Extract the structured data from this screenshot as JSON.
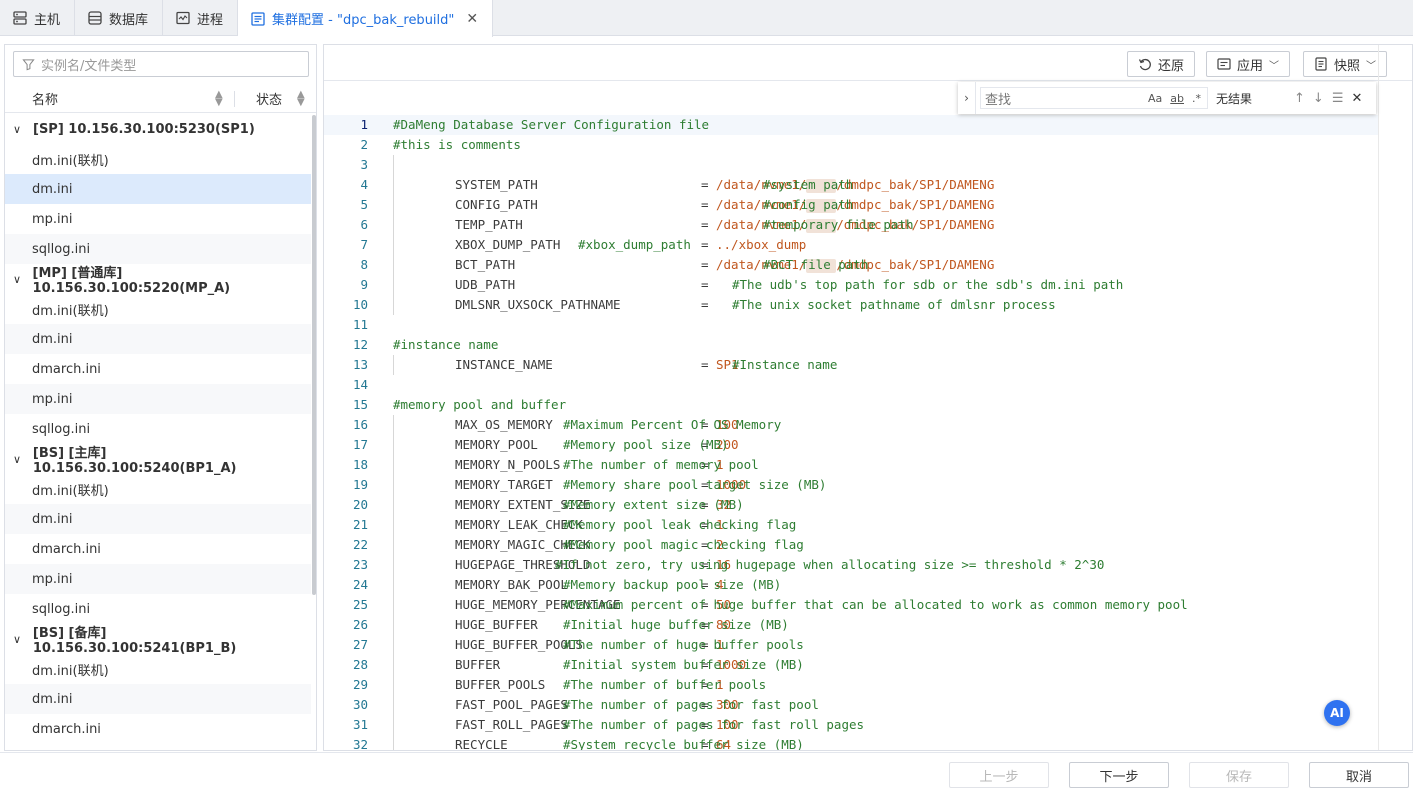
{
  "tabs": [
    {
      "label": "主机",
      "icon": "server-icon"
    },
    {
      "label": "数据库",
      "icon": "database-icon"
    },
    {
      "label": "进程",
      "icon": "process-icon"
    },
    {
      "label": "集群配置 - \"dpc_bak_rebuild\"",
      "icon": "cluster-config-icon",
      "active": true
    }
  ],
  "sidebar": {
    "search_placeholder": "实例名/文件类型",
    "col_name": "名称",
    "col_status": "状态",
    "groups": [
      {
        "label": "[SP] 10.156.30.100:5230(SP1)",
        "files": [
          "dm.ini(联机)",
          "dm.ini",
          "mp.ini",
          "sqllog.ini"
        ]
      },
      {
        "label": "[MP] [普通库] 10.156.30.100:5220(MP_A)",
        "files": [
          "dm.ini(联机)",
          "dm.ini",
          "dmarch.ini",
          "mp.ini",
          "sqllog.ini"
        ]
      },
      {
        "label": "[BS] [主库] 10.156.30.100:5240(BP1_A)",
        "files": [
          "dm.ini(联机)",
          "dm.ini",
          "dmarch.ini",
          "mp.ini",
          "sqllog.ini"
        ]
      },
      {
        "label": "[BS] [备库] 10.156.30.100:5241(BP1_B)",
        "files": [
          "dm.ini(联机)",
          "dm.ini",
          "dmarch.ini"
        ]
      }
    ],
    "selected": "0.1"
  },
  "toolbar": {
    "restore": "还原",
    "apply": "应用",
    "snapshot": "快照"
  },
  "find": {
    "placeholder": "查找",
    "opt_case": "Aa",
    "opt_word": "ab",
    "opt_regex": ".*",
    "result": "无结果"
  },
  "editor": {
    "lines": [
      {
        "n": "1",
        "type": "comment",
        "text": "#DaMeng Database Server Configuration file"
      },
      {
        "n": "2",
        "type": "comment",
        "text": "#this is comments"
      },
      {
        "n": "3",
        "type": "blank"
      },
      {
        "n": "4",
        "key": "SYSTEM_PATH",
        "pre": "/data/nvme1/",
        "masked": true,
        "post": "/dmdpc_bak/SP1/DAMENG",
        "comment": "#system path",
        "col": 762
      },
      {
        "n": "5",
        "key": "CONFIG_PATH",
        "pre": "/data/nvme1/",
        "masked": true,
        "post": "/dmdpc_bak/SP1/DAMENG",
        "comment": "#config path",
        "col": 762
      },
      {
        "n": "6",
        "key": "TEMP_PATH",
        "pre": "/data/nvme1/",
        "masked": true,
        "post": "/dmdpc_bak/SP1/DAMENG",
        "comment": "#temporary file path",
        "col": 762
      },
      {
        "n": "7",
        "key": "XBOX_DUMP_PATH",
        "pre": "../xbox_dump",
        "comment": "#xbox_dump_path",
        "col": 577
      },
      {
        "n": "8",
        "key": "BCT_PATH",
        "pre": "/data/nvme1/",
        "masked": true,
        "post": "/dmdpc_bak/SP1/DAMENG",
        "comment": "#BCT file path",
        "col": 762
      },
      {
        "n": "9",
        "key": "UDB_PATH",
        "pre": "",
        "comment": "#The udb's top path for sdb or the sdb's dm.ini path",
        "col": 731
      },
      {
        "n": "10",
        "key": "DMLSNR_UXSOCK_PATHNAME",
        "pre": "",
        "comment": "#The unix socket pathname of dmlsnr process",
        "col": 731
      },
      {
        "n": "11",
        "type": "blank"
      },
      {
        "n": "12",
        "type": "comment",
        "text": "#instance name"
      },
      {
        "n": "13",
        "key": "INSTANCE_NAME",
        "pre": "SP1",
        "comment": "#Instance name",
        "col": 731
      },
      {
        "n": "14",
        "type": "blank"
      },
      {
        "n": "15",
        "type": "comment",
        "text": "#memory pool and buffer"
      },
      {
        "n": "16",
        "key": "MAX_OS_MEMORY",
        "pre": "100",
        "comment": "#Maximum Percent Of OS Memory",
        "col": 562
      },
      {
        "n": "17",
        "key": "MEMORY_POOL",
        "pre": "200",
        "comment": "#Memory pool size (MB)",
        "col": 562
      },
      {
        "n": "18",
        "key": "MEMORY_N_POOLS",
        "pre": "1",
        "comment": "#The number of memory pool",
        "col": 562
      },
      {
        "n": "19",
        "key": "MEMORY_TARGET",
        "pre": "1000",
        "comment": "#Memory share pool target size (MB)",
        "col": 562
      },
      {
        "n": "20",
        "key": "MEMORY_EXTENT_SIZE",
        "pre": "32",
        "comment": "#Memory extent size (MB)",
        "col": 562
      },
      {
        "n": "21",
        "key": "MEMORY_LEAK_CHECK",
        "pre": "1",
        "comment": "#Memory pool leak checking flag",
        "col": 562
      },
      {
        "n": "22",
        "key": "MEMORY_MAGIC_CHECK",
        "pre": "2",
        "comment": "#Memory pool magic checking flag",
        "col": 562
      },
      {
        "n": "23",
        "key": "HUGEPAGE_THRESHOLD",
        "pre": "16",
        "comment": "#If not zero, try using hugepage when allocating size >= threshold * 2^30",
        "col": 554
      },
      {
        "n": "24",
        "key": "MEMORY_BAK_POOL",
        "pre": "4",
        "comment": "#Memory backup pool size (MB)",
        "col": 562
      },
      {
        "n": "25",
        "key": "HUGE_MEMORY_PERCENTAGE",
        "pre": "50",
        "comment": "#Maximum percent of huge buffer that can be allocated to work as common memory pool",
        "col": 562
      },
      {
        "n": "26",
        "key": "HUGE_BUFFER",
        "pre": "80",
        "comment": "#Initial huge buffer size (MB)",
        "col": 562
      },
      {
        "n": "27",
        "key": "HUGE_BUFFER_POOLS",
        "pre": "1",
        "comment": "#The number of huge buffer pools",
        "col": 562
      },
      {
        "n": "28",
        "key": "BUFFER",
        "pre": "1000",
        "comment": "#Initial system buffer size (MB)",
        "col": 562
      },
      {
        "n": "29",
        "key": "BUFFER_POOLS",
        "pre": "1",
        "comment": "#The number of buffer pools",
        "col": 562
      },
      {
        "n": "30",
        "key": "FAST_POOL_PAGES",
        "pre": "300",
        "comment": "#The number of pages for fast pool",
        "col": 562
      },
      {
        "n": "31",
        "key": "FAST_ROLL_PAGES",
        "pre": "100",
        "comment": "#The number of pages for fast roll pages",
        "col": 562
      },
      {
        "n": "32",
        "key": "RECYCLE",
        "pre": "64",
        "comment": "#System recycle buffer size (MB)",
        "col": 562
      }
    ],
    "eq": "="
  },
  "ai_badge": "AI",
  "footer": {
    "prev": "上一步",
    "next": "下一步",
    "save": "保存",
    "cancel": "取消"
  }
}
